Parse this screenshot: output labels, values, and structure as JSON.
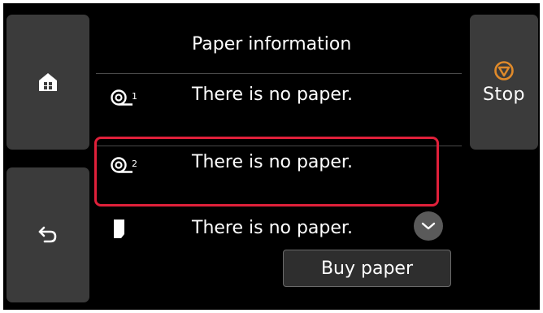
{
  "header": {
    "title": "Paper information"
  },
  "buttons": {
    "home_icon": "home-icon",
    "back_icon": "back-arrow-icon",
    "stop_label": "Stop",
    "stop_icon": "stop-icon",
    "buy_label": "Buy paper",
    "scroll_icon": "chevron-down-icon"
  },
  "paper_sources": [
    {
      "icon": "roll-1-icon",
      "badge": "1",
      "status": "There is no paper."
    },
    {
      "icon": "roll-2-icon",
      "badge": "2",
      "status": "There is no paper."
    },
    {
      "icon": "cut-sheet-icon",
      "status": "There is no paper."
    }
  ],
  "colors": {
    "background": "#000000",
    "button": "#3b3b3b",
    "stop_accent": "#e08a2a",
    "highlight": "#e0203a"
  }
}
